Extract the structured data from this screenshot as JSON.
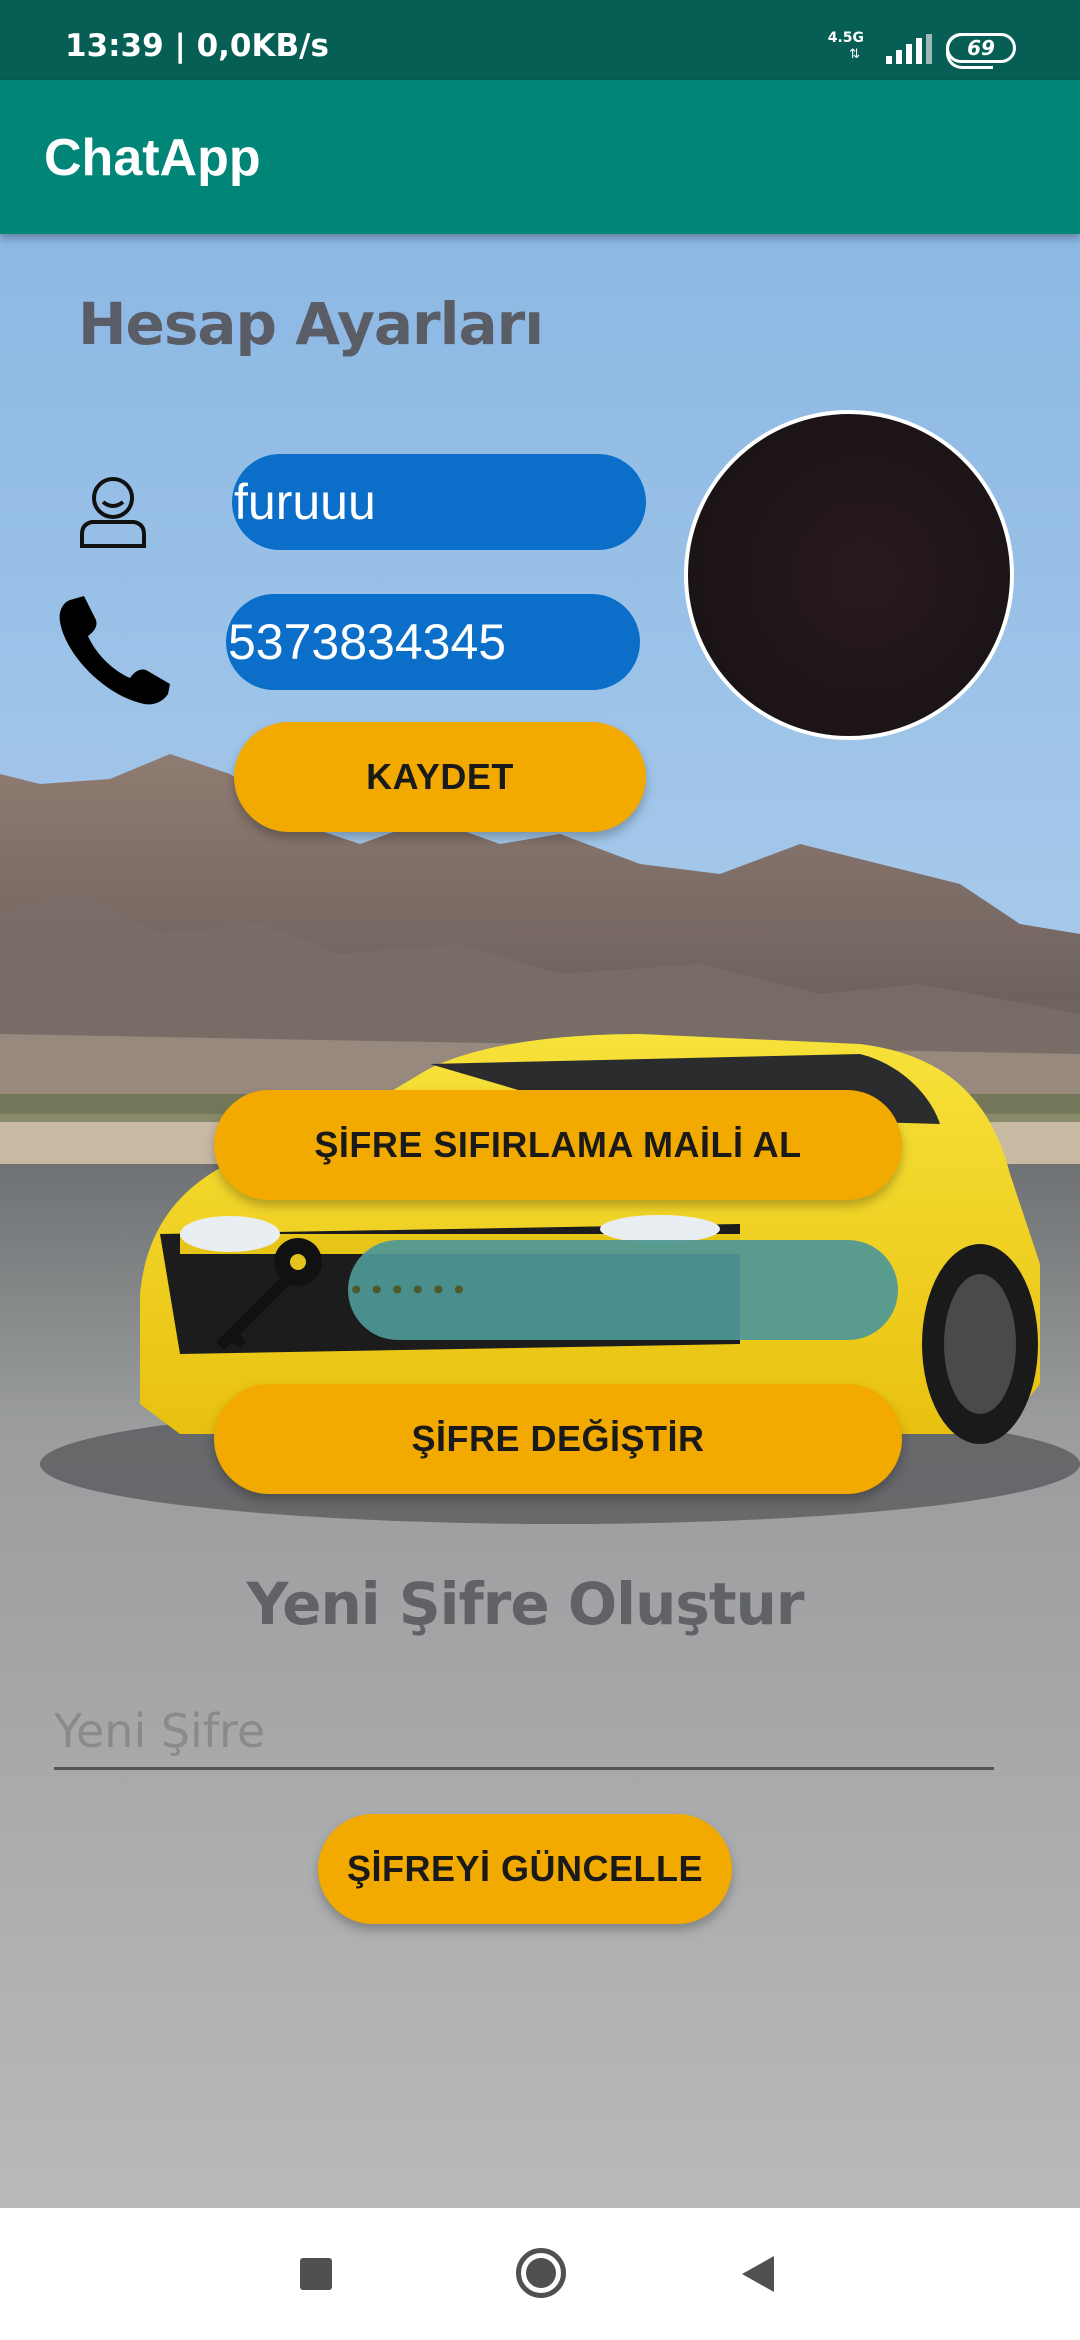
{
  "status_bar": {
    "time": "13:39 | 0,0KB/s",
    "network": "4.5G",
    "battery": "69"
  },
  "app_bar": {
    "title": "ChatApp"
  },
  "account": {
    "title": "Hesap Ayarları",
    "username": "furuuu",
    "phone": "5373834345",
    "save_label": "KAYDET"
  },
  "password": {
    "reset_mail_label": "ŞİFRE SIFIRLAMA MAİLİ AL",
    "masked_value": "••••••",
    "change_label": "ŞİFRE DEĞİŞTİR"
  },
  "new_password": {
    "title": "Yeni Şifre Oluştur",
    "placeholder": "Yeni Şifre",
    "update_label": "ŞİFREYİ GÜNCELLE"
  },
  "icons": {
    "user": "user-outline-icon",
    "phone": "phone-icon",
    "key": "key-icon"
  },
  "colors": {
    "status_bar": "#075e54",
    "app_bar": "#008577",
    "input_blue": "#0b6fc9",
    "button_orange": "#f2a900",
    "password_teal": "#4e9896"
  }
}
